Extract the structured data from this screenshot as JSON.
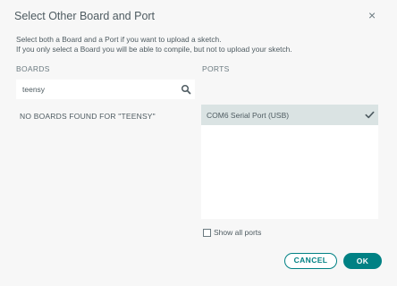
{
  "dialog": {
    "title": "Select Other Board and Port",
    "close_glyph": "×",
    "description_line1": "Select both a Board and a Port if you want to upload a sketch.",
    "description_line2": "If you only select a Board you will be able to compile, but not to upload your sketch."
  },
  "boards": {
    "label": "BOARDS",
    "search_value": "teensy",
    "empty_message": "NO BOARDS FOUND FOR \"TEENSY\""
  },
  "ports": {
    "label": "PORTS",
    "items": [
      {
        "label": "COM6 Serial Port (USB)",
        "selected": true
      }
    ],
    "show_all_label": "Show all ports",
    "show_all_checked": false
  },
  "buttons": {
    "cancel": "CANCEL",
    "ok": "OK"
  },
  "colors": {
    "accent": "#008184",
    "selected_row": "#dae3e3",
    "background": "#f7f7f7"
  }
}
